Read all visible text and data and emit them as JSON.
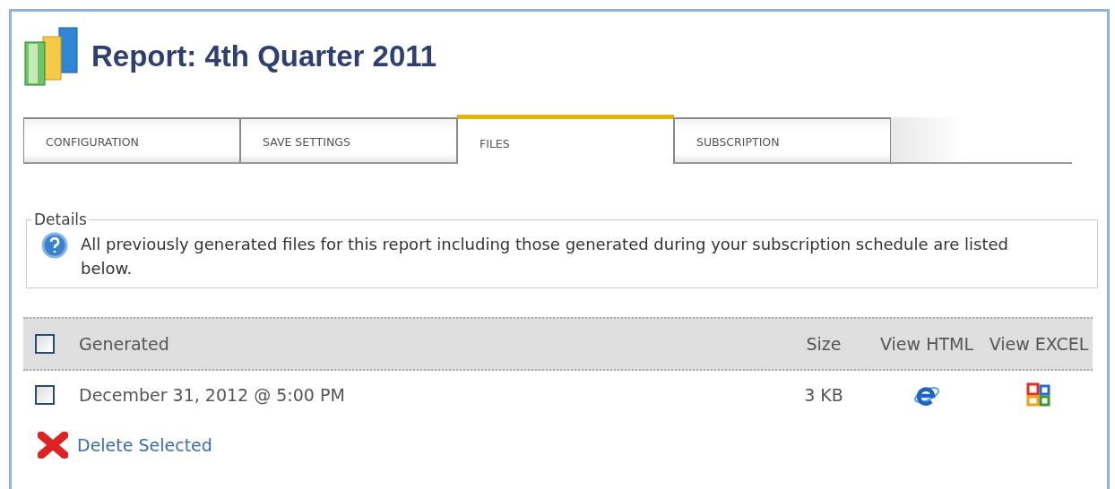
{
  "title": "Report: 4th Quarter 2011",
  "tabs": [
    {
      "label": "CONFIGURATION",
      "selected": false
    },
    {
      "label": "SAVE SETTINGS",
      "selected": false
    },
    {
      "label": "FILES",
      "selected": true
    },
    {
      "label": "SUBSCRIPTION",
      "selected": false
    }
  ],
  "details": {
    "legend": "Details",
    "text": "All previously generated files for this report including those generated during your subscription schedule are listed below."
  },
  "table": {
    "columns": [
      "Generated",
      "Size",
      "View HTML",
      "View EXCEL"
    ],
    "header_checked": false,
    "rows": [
      {
        "generated": "December 31, 2012 @ 5:00 PM",
        "size": "3 KB",
        "checked": false
      }
    ]
  },
  "delete_action": "Delete Selected"
}
